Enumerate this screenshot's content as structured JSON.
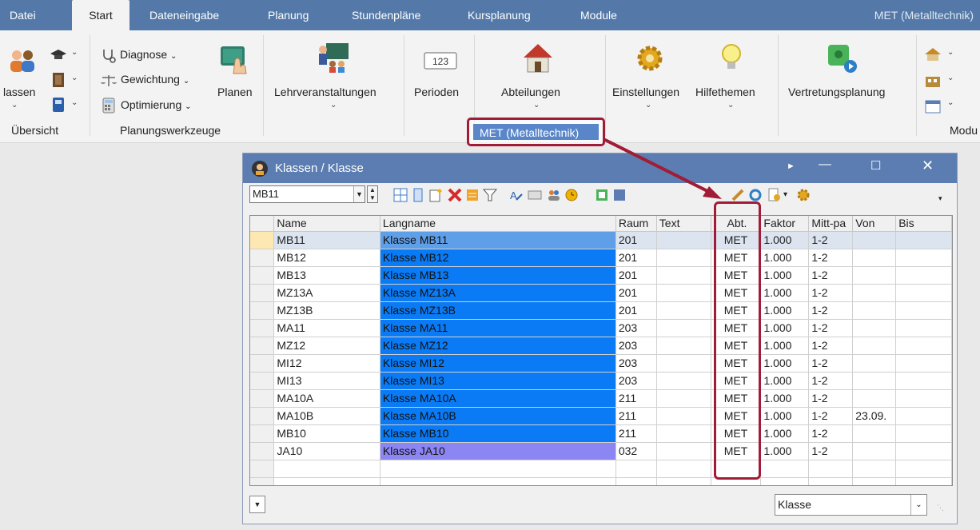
{
  "menu": {
    "tabs": [
      "Datei",
      "Start",
      "Dateneingabe",
      "Planung",
      "Stundenpläne",
      "Kursplanung",
      "Module"
    ],
    "right_title": "MET (Metalltechnik)"
  },
  "ribbon": {
    "klassen_label": "lassen",
    "diagnose": "Diagnose",
    "gewichtung": "Gewichtung",
    "optimierung": "Optimierung",
    "planen": "Planen",
    "lehrveranstaltungen": "Lehrveranstaltungen",
    "perioden": "Perioden",
    "perioden_icon_text": "123",
    "abteilungen": "Abteilungen",
    "einstellungen": "Einstellungen",
    "hilfethemen": "Hilfethemen",
    "vertretungsplanung": "Vertretungsplanung",
    "group_uebersicht": "Übersicht",
    "group_planungswerkzeuge": "Planungswerkzeuge",
    "group_module": "Modu",
    "met_selector": "MET (Metalltechnik)"
  },
  "window": {
    "title": "Klassen / Klasse",
    "current_class": "MB11",
    "bottom_combo": "Klasse",
    "columns": [
      "Name",
      "Langname",
      "Raum",
      "Text",
      "Abt.",
      "Faktor",
      "Mitt-pa",
      "Von",
      "Bis"
    ],
    "rows": [
      {
        "name": "MB11",
        "lang": "Klasse MB11",
        "raum": "201",
        "text": "",
        "abt": "MET",
        "faktor": "1.000",
        "mitt": "1-2",
        "von": "",
        "bis": ""
      },
      {
        "name": "MB12",
        "lang": "Klasse MB12",
        "raum": "201",
        "text": "",
        "abt": "MET",
        "faktor": "1.000",
        "mitt": "1-2",
        "von": "",
        "bis": ""
      },
      {
        "name": "MB13",
        "lang": "Klasse MB13",
        "raum": "201",
        "text": "",
        "abt": "MET",
        "faktor": "1.000",
        "mitt": "1-2",
        "von": "",
        "bis": ""
      },
      {
        "name": "MZ13A",
        "lang": "Klasse MZ13A",
        "raum": "201",
        "text": "",
        "abt": "MET",
        "faktor": "1.000",
        "mitt": "1-2",
        "von": "",
        "bis": ""
      },
      {
        "name": "MZ13B",
        "lang": "Klasse MZ13B",
        "raum": "201",
        "text": "",
        "abt": "MET",
        "faktor": "1.000",
        "mitt": "1-2",
        "von": "",
        "bis": ""
      },
      {
        "name": "MA11",
        "lang": "Klasse MA11",
        "raum": "203",
        "text": "",
        "abt": "MET",
        "faktor": "1.000",
        "mitt": "1-2",
        "von": "",
        "bis": ""
      },
      {
        "name": "MZ12",
        "lang": "Klasse MZ12",
        "raum": "203",
        "text": "",
        "abt": "MET",
        "faktor": "1.000",
        "mitt": "1-2",
        "von": "",
        "bis": ""
      },
      {
        "name": "MI12",
        "lang": "Klasse MI12",
        "raum": "203",
        "text": "",
        "abt": "MET",
        "faktor": "1.000",
        "mitt": "1-2",
        "von": "",
        "bis": ""
      },
      {
        "name": "MI13",
        "lang": "Klasse MI13",
        "raum": "203",
        "text": "",
        "abt": "MET",
        "faktor": "1.000",
        "mitt": "1-2",
        "von": "",
        "bis": ""
      },
      {
        "name": "MA10A",
        "lang": "Klasse MA10A",
        "raum": "211",
        "text": "",
        "abt": "MET",
        "faktor": "1.000",
        "mitt": "1-2",
        "von": "",
        "bis": ""
      },
      {
        "name": "MA10B",
        "lang": "Klasse MA10B",
        "raum": "211",
        "text": "",
        "abt": "MET",
        "faktor": "1.000",
        "mitt": "1-2",
        "von": "23.09.",
        "bis": ""
      },
      {
        "name": "MB10",
        "lang": "Klasse MB10",
        "raum": "211",
        "text": "",
        "abt": "MET",
        "faktor": "1.000",
        "mitt": "1-2",
        "von": "",
        "bis": ""
      },
      {
        "name": "JA10",
        "lang": "Klasse JA10",
        "raum": "032",
        "text": "",
        "abt": "MET",
        "faktor": "1.000",
        "mitt": "1-2",
        "von": "",
        "bis": ""
      }
    ]
  },
  "colors": {
    "title_blue": "#5479a8",
    "langname_blue": "#0a7bf5",
    "highlight_red": "#a11c36",
    "violet_row": "#8b86f2"
  }
}
